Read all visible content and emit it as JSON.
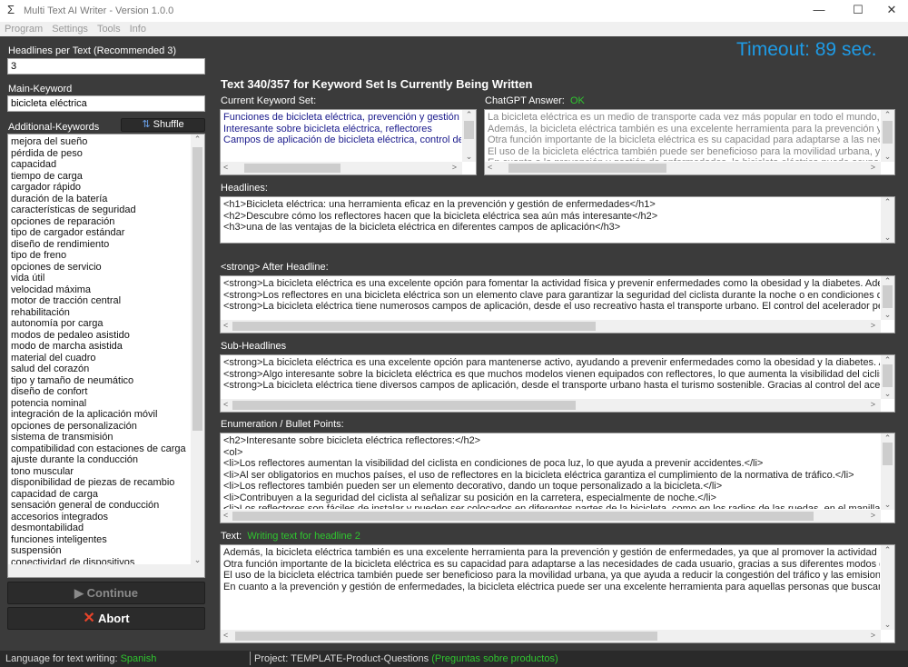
{
  "window": {
    "title": "Multi Text AI Writer - Version 1.0.0",
    "icon": "sigma-icon",
    "controls": [
      "minimize",
      "maximize",
      "close"
    ]
  },
  "menu": [
    "Program",
    "Settings",
    "Tools",
    "Info"
  ],
  "left": {
    "headlines_label": "Headlines per Text (Recommended 3)",
    "headlines_value": "3",
    "main_keyword_label": "Main-Keyword",
    "main_keyword_value": "bicicleta eléctrica",
    "additional_label": "Additional-Keywords",
    "shuffle_label": "Shuffle",
    "keywords": [
      "mejora del sueño",
      "pérdida de peso",
      "capacidad",
      "tiempo de carga",
      "cargador rápido",
      "duración de la batería",
      "características de seguridad",
      "opciones de reparación",
      "tipo de cargador estándar",
      "diseño de rendimiento",
      "tipo de freno",
      "opciones de servicio",
      "vida útil",
      "velocidad máxima",
      "motor de tracción central",
      "rehabilitación",
      "autonomía por carga",
      "modos de pedaleo asistido",
      "modo de marcha asistida",
      "material del cuadro",
      "salud del corazón",
      "tipo y tamaño de neumático",
      "diseño de confort",
      "potencia nominal",
      "integración de la aplicación móvil",
      "opciones de personalización",
      "sistema de transmisión",
      "compatibilidad con estaciones de carga",
      "ajuste durante la conducción",
      "tono muscular",
      "disponibilidad de piezas de recambio",
      "capacidad de carga",
      "sensación general de conducción",
      "accesorios integrados",
      "desmontabilidad",
      "funciones inteligentes",
      "suspensión",
      "conectividad de dispositivos"
    ],
    "continue_label": "Continue",
    "abort_label": "Abort"
  },
  "main": {
    "timeout": "Timeout: 89 sec.",
    "heading": "Text 340/357 for Keyword Set Is Currently Being Written",
    "keyword_set": {
      "label": "Current Keyword Set:",
      "lines": [
        "Funciones de bicicleta eléctrica, prevención y gestión de",
        "Interesante sobre bicicleta eléctrica, reflectores",
        "Campos de aplicación de bicicleta eléctrica, control del a"
      ]
    },
    "chatgpt": {
      "label": "ChatGPT Answer:",
      "status": "OK",
      "lines": [
        "La bicicleta eléctrica es un medio de transporte cada vez más popular en todo el mundo, grac",
        "Además, la bicicleta eléctrica también es una excelente herramienta para la prevención y ges",
        "Otra función importante de la bicicleta eléctrica es su capacidad para adaptarse a las necesic",
        "El uso de la bicicleta eléctrica también puede ser beneficioso para la movilidad urbana, ya qu",
        "En cuanto a la prevención y gestión de enfermedades, la bicicleta eléctrica puede ocupar un"
      ]
    },
    "headlines": {
      "label": "Headlines:",
      "lines": [
        "<h1>Bicicleta eléctrica: una herramienta eficaz en la prevención y gestión de enfermedades</h1>",
        "<h2>Descubre cómo los reflectores hacen que la bicicleta eléctrica sea aún más interesante</h2>",
        "<h3>una de las ventajas de la bicicleta eléctrica en diferentes campos de aplicación</h3>"
      ]
    },
    "after_headline": {
      "label": "<strong> After Headline:",
      "lines": [
        "<strong>La bicicleta eléctrica es una excelente opción para fomentar la actividad física y prevenir enfermedades como la obesidad y la diabetes. Además, s",
        "<strong>Los reflectores en una bicicleta eléctrica son un elemento clave para garantizar la seguridad del ciclista durante la noche o en condiciones de poca v",
        "<strong>La bicicleta eléctrica tiene numerosos campos de aplicación, desde el uso recreativo hasta el transporte urbano. El control del acelerador permite a"
      ]
    },
    "sub_headlines": {
      "label": "Sub-Headlines",
      "lines": [
        "<strong>La bicicleta eléctrica es una excelente opción para mantenerse activo, ayudando a prevenir enfermedades como la obesidad y la diabetes. Ademá",
        "<strong>Algo interesante sobre la bicicleta eléctrica es que muchos modelos vienen equipados con reflectores, lo que aumenta la visibilidad del ciclista dura",
        "<strong>La bicicleta eléctrica tiene diversos campos de aplicación, desde el transporte urbano hasta el turismo sostenible. Gracias al control del acelerador,"
      ]
    },
    "enumeration": {
      "label": "Enumeration / Bullet Points:",
      "lines": [
        "<h2>Interesante sobre bicicleta eléctrica reflectores:</h2>",
        "<ol>",
        "<li>Los reflectores aumentan la visibilidad del ciclista en condiciones de poca luz, lo que ayuda a prevenir accidentes.</li>",
        "<li>Al ser obligatorios en muchos países, el uso de reflectores en la bicicleta eléctrica garantiza el cumplimiento de la normativa de tráfico.</li>",
        "<li>Los reflectores también pueden ser un elemento decorativo, dando un toque personalizado a la bicicleta.</li>",
        "<li>Contribuyen a la seguridad del ciclista al señalizar su posición en la carretera, especialmente de noche.</li>",
        "<li>Los reflectores son fáciles de instalar y pueden ser colocados en diferentes partes de la bicicleta, como en los radios de las ruedas, en el manillar o en el"
      ]
    },
    "text": {
      "label": "Text:",
      "status": "Writing text for headline 2",
      "lines": [
        "Además, la bicicleta eléctrica también es una excelente herramienta para la prevención y gestión de enfermedades, ya que al promover la actividad física ay",
        "Otra función importante de la bicicleta eléctrica es su capacidad para adaptarse a las necesidades de cada usuario, gracias a sus diferentes modos de asis",
        "El uso de la bicicleta eléctrica también puede ser beneficioso para la movilidad urbana, ya que ayuda a reducir la congestión del tráfico y las emisiones de g",
        "En cuanto a la prevención y gestión de enfermedades, la bicicleta eléctrica puede ser una excelente herramienta para aquellas personas que buscan mejora"
      ]
    }
  },
  "status": {
    "language_label": "Language for text writing:",
    "language": "Spanish",
    "project_label": "Project: TEMPLATE-Product-Questions",
    "project_note": "(Preguntas sobre productos)"
  },
  "colors": {
    "background": "#3b3b3b",
    "timeout": "#1e9be6",
    "ok": "#2fc62f",
    "keyword_text": "#1a1a8c",
    "abort_icon": "#e8442a"
  }
}
